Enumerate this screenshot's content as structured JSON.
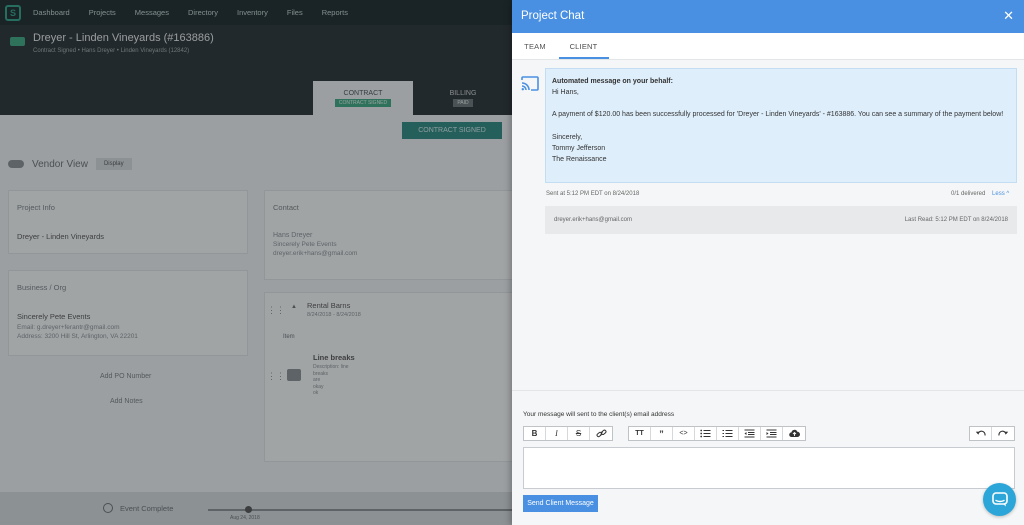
{
  "app": {
    "nav": [
      "Dashboard",
      "Projects",
      "Messages",
      "Directory",
      "Inventory",
      "Files",
      "Reports"
    ],
    "project_title": "Dreyer - Linden Vineyards (#163886)",
    "project_sub": "Contract Signed  •  Hans Dreyer  •  Linden Vineyards (12842)",
    "tabs": [
      {
        "label": "CONTRACT",
        "pill": "CONTRACT SIGNED"
      },
      {
        "label": "BILLING",
        "pill": "PAID"
      }
    ],
    "contract_button": "CONTRACT SIGNED",
    "vendor_view": "Vendor View",
    "display_label": "Display",
    "project_info": {
      "heading": "Project Info",
      "value": "Dreyer - Linden Vineyards"
    },
    "business": {
      "heading": "Business / Org",
      "name": "Sincerely Pete Events",
      "email": "Email: g.dreyer+ferantr@gmail.com",
      "address": "Address: 3200 Hill St, Arlington, VA 22201"
    },
    "contact": {
      "heading": "Contact",
      "name": "Hans Dreyer",
      "org": "Sincerely Pete Events",
      "email": "dreyer.erik+hans@gmail.com"
    },
    "rental": {
      "title": "Rental Barns",
      "dates": "8/24/2018 - 8/24/2018",
      "item_label": "Item",
      "line_breaks": "Line breaks",
      "line_desc": [
        "Description: line",
        "breaks",
        "are",
        "okay",
        "ok"
      ]
    },
    "add_po": "Add PO Number",
    "add_notes": "Add Notes",
    "event_complete": "Event Complete",
    "progress_date": "Aug 24, 2018"
  },
  "panel": {
    "title": "Project Chat",
    "close_glyph": "✕",
    "tabs": [
      "TEAM",
      "CLIENT"
    ],
    "active_tab": "CLIENT",
    "message": {
      "title": "Automated message on your behalf:",
      "greeting": "Hi Hans,",
      "body": "A payment of $120.00 has been successfully processed for 'Dreyer - Linden Vineyards' - #163886. You can see a summary of the payment below!",
      "closing": "Sincerely,",
      "sender_name": "Tommy Jefferson",
      "sender_org": "The Renaissance"
    },
    "sent_at": "Sent at 5:12 PM EDT on 8/24/2018",
    "delivered": "0/1 delivered",
    "less": "Less ^",
    "recipient_email": "dreyer.erik+hans@gmail.com",
    "last_read": "Last Read: 5:12 PM EDT on 8/24/2018",
    "compose_note": "Your message will sent to the client(s) email address",
    "editor_placeholder": "",
    "send_label": "Send Client Message"
  },
  "colors": {
    "accent": "#4a90e2",
    "bubble": "#deeefb",
    "fab": "#2ca6d8"
  }
}
